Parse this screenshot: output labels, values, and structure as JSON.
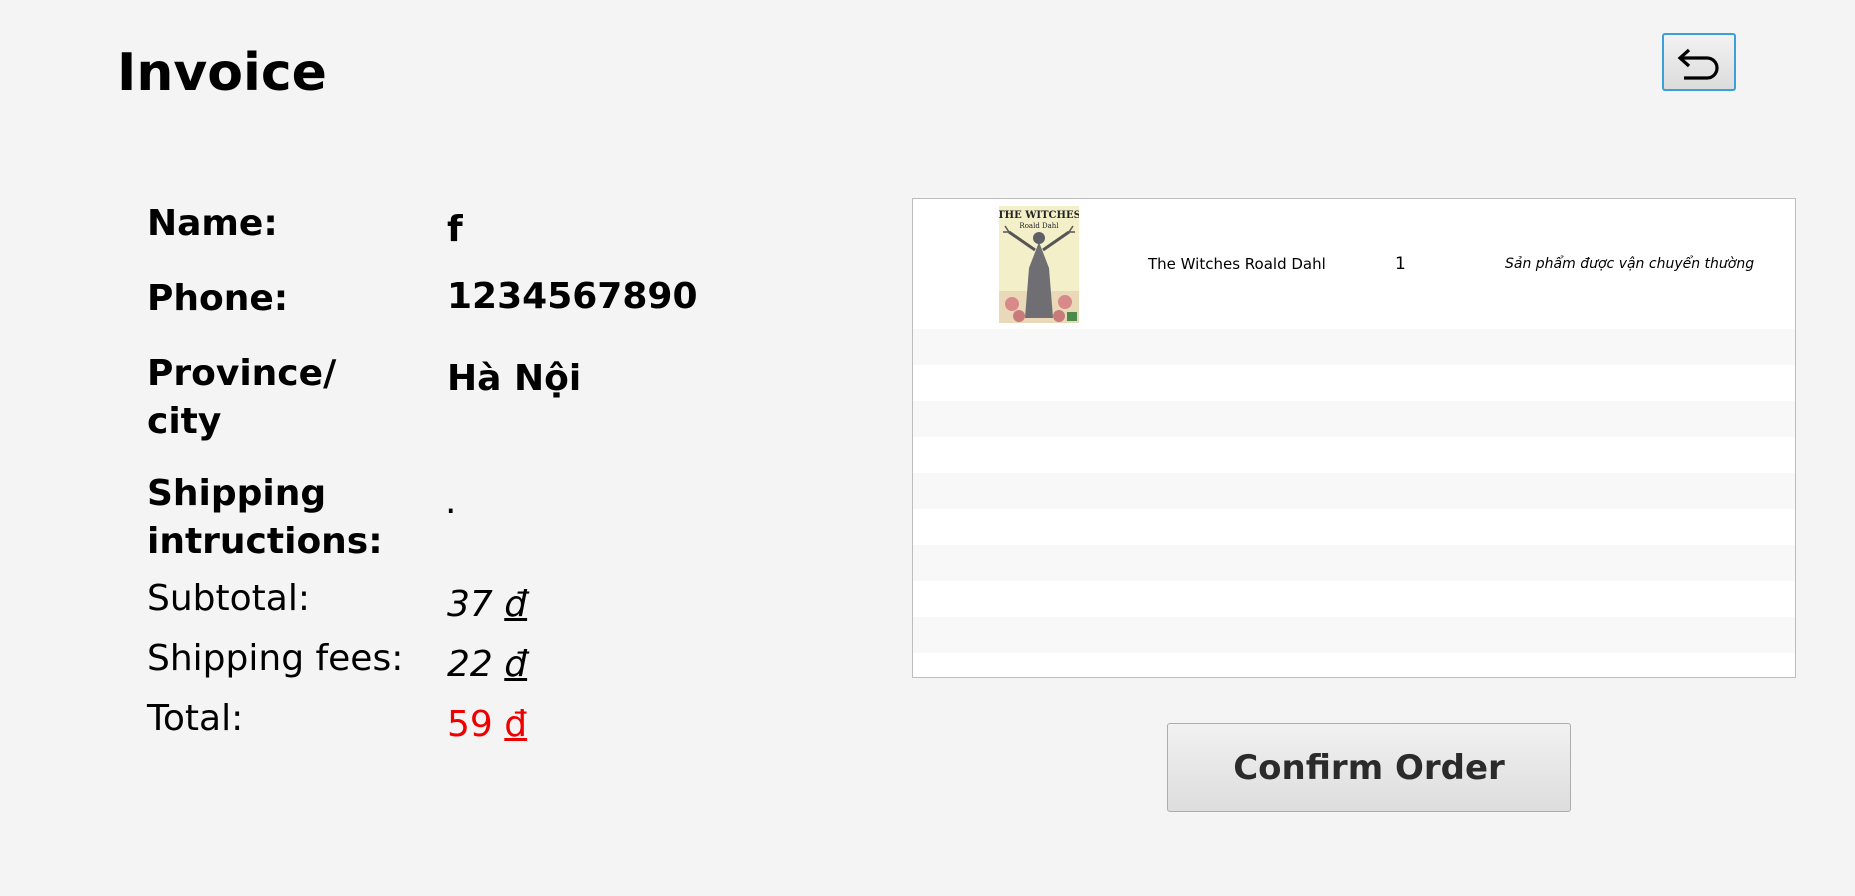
{
  "page": {
    "title": "Invoice"
  },
  "header": {
    "back_icon": "undo-arrow-icon"
  },
  "customer": {
    "name_label": "Name:",
    "name_value": "f",
    "phone_label": "Phone:",
    "phone_value": "1234567890",
    "province_label_line1": "Province/",
    "province_label_line2": "city",
    "province_value": "Hà Nội",
    "shipping_label_line1": "Shipping",
    "shipping_label_line2": "intructions:",
    "shipping_value": "."
  },
  "totals": {
    "subtotal_label": "Subtotal:",
    "subtotal_amount": "37",
    "shipping_fees_label": "Shipping fees:",
    "shipping_fees_amount": "22",
    "total_label": "Total:",
    "total_amount": "59",
    "currency": "đ",
    "total_color": "#ee0000"
  },
  "order_items": [
    {
      "title": "The Witches Roald Dahl",
      "quantity": "1",
      "note": "Sản phẩm được vận chuyển thường",
      "cover_text_title": "THE WITCHES",
      "cover_text_author": "Roald Dahl"
    }
  ],
  "actions": {
    "confirm_label": "Confirm Order"
  }
}
